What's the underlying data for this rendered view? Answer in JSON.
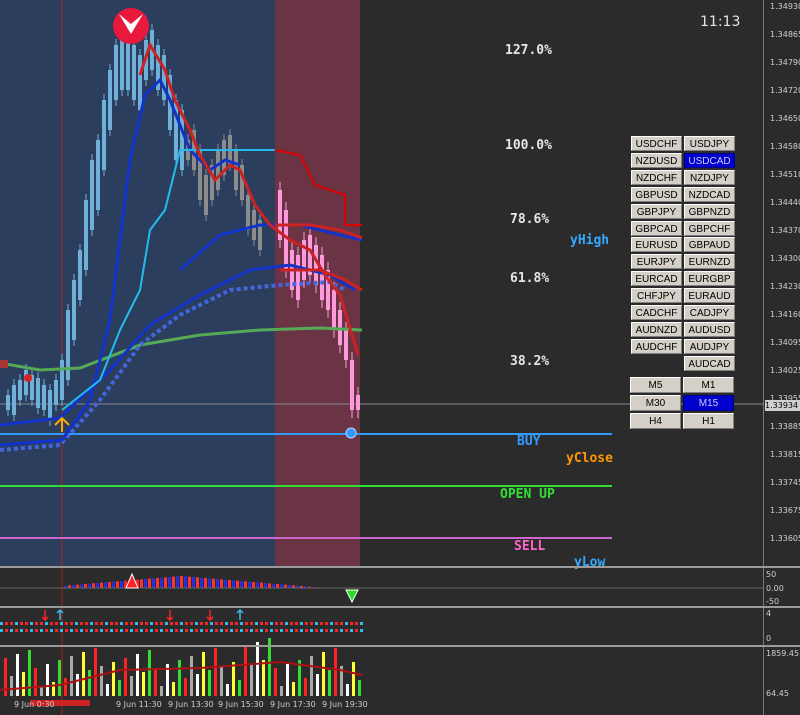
{
  "clock": "11:13",
  "fib_levels": [
    "127.0%",
    "100.0%",
    "78.6%",
    "61.8%",
    "38.2%"
  ],
  "labels": {
    "yhigh": "yHigh",
    "buy": "BUY",
    "yclose": "yClose",
    "open_up": "OPEN UP",
    "sell": "SELL",
    "ylow": "yLow"
  },
  "colors": {
    "background": "#2b2b2b",
    "session_blue": "#2b3e5e",
    "session_red": "#6b3445",
    "buy": "#3399ff",
    "yclose": "#ff9900",
    "open_up": "#33dd33",
    "sell": "#ff66cc",
    "yhigh": "#33aaff",
    "selected_button": "#0000cc"
  },
  "symbol_buttons": [
    {
      "label": "USDCHF",
      "selected": false
    },
    {
      "label": "USDJPY",
      "selected": false
    },
    {
      "label": "NZDUSD",
      "selected": false
    },
    {
      "label": "USDCAD",
      "selected": true
    },
    {
      "label": "NZDCHF",
      "selected": false
    },
    {
      "label": "NZDJPY",
      "selected": false
    },
    {
      "label": "GBPUSD",
      "selected": false
    },
    {
      "label": "NZDCAD",
      "selected": false
    },
    {
      "label": "GBPJPY",
      "selected": false
    },
    {
      "label": "GBPNZD",
      "selected": false
    },
    {
      "label": "GBPCAD",
      "selected": false
    },
    {
      "label": "GBPCHF",
      "selected": false
    },
    {
      "label": "EURUSD",
      "selected": false
    },
    {
      "label": "GBPAUD",
      "selected": false
    },
    {
      "label": "EURJPY",
      "selected": false
    },
    {
      "label": "EURNZD",
      "selected": false
    },
    {
      "label": "EURCAD",
      "selected": false
    },
    {
      "label": "EURGBP",
      "selected": false
    },
    {
      "label": "CHFJPY",
      "selected": false
    },
    {
      "label": "EURAUD",
      "selected": false
    },
    {
      "label": "CADCHF",
      "selected": false
    },
    {
      "label": "CADJPY",
      "selected": false
    },
    {
      "label": "AUDNZD",
      "selected": false
    },
    {
      "label": "AUDUSD",
      "selected": false
    },
    {
      "label": "AUDCHF",
      "selected": false
    },
    {
      "label": "AUDJPY",
      "selected": false
    },
    {
      "label": "",
      "selected": false,
      "hidden": true
    },
    {
      "label": "AUDCAD",
      "selected": false
    }
  ],
  "timeframe_buttons": [
    {
      "label": "M5",
      "selected": false
    },
    {
      "label": "M1",
      "selected": false
    },
    {
      "label": "M30",
      "selected": false
    },
    {
      "label": "M15",
      "selected": true
    },
    {
      "label": "H4",
      "selected": false
    },
    {
      "label": "H1",
      "selected": false
    }
  ],
  "price_axis": [
    "1.34930",
    "1.34865",
    "1.34790",
    "1.34720",
    "1.34650",
    "1.34580",
    "1.34510",
    "1.34440",
    "1.34370",
    "1.34300",
    "1.34230",
    "1.34160",
    "1.34095",
    "1.34025",
    "1.33955",
    "1.33885",
    "1.33815",
    "1.33745",
    "1.33675",
    "1.33605"
  ],
  "current_price": "1.33934",
  "time_axis": [
    "9 Jun 0:30",
    "9 Jun 11:30",
    "9 Jun 13:30",
    "9 Jun 15:30",
    "9 Jun 17:30",
    "9 Jun 19:30"
  ],
  "indicator1_ticks": [
    "50",
    "0.00",
    "-50"
  ],
  "indicator2_ticks": [
    "4",
    "0"
  ],
  "indicator3_ticks": [
    "1859.45",
    "64.45"
  ]
}
